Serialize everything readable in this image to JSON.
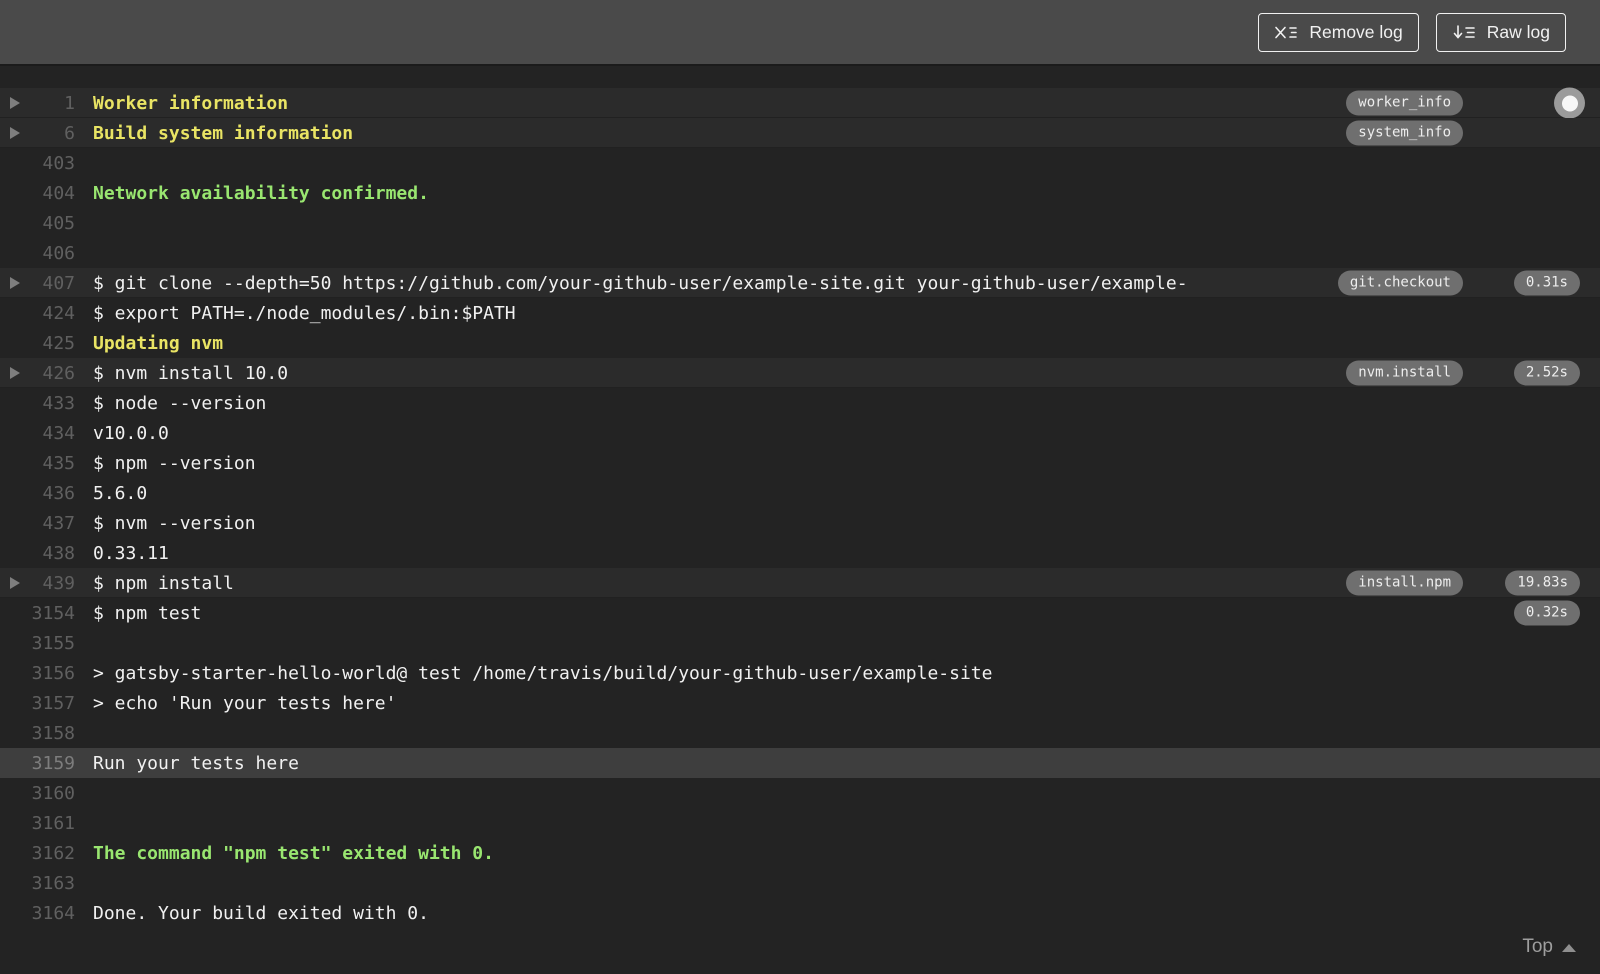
{
  "header": {
    "remove_log_label": "Remove log",
    "raw_log_label": "Raw log"
  },
  "log": {
    "rows": [
      {
        "num": "1",
        "text": "Worker information",
        "color": "yellow",
        "fold": true,
        "arrow": true,
        "tag": "worker_info",
        "knob": true
      },
      {
        "num": "6",
        "text": "Build system information",
        "color": "yellow",
        "fold": true,
        "arrow": true,
        "tag": "system_info"
      },
      {
        "num": "403",
        "text": ""
      },
      {
        "num": "404",
        "text": "Network availability confirmed.",
        "color": "green"
      },
      {
        "num": "405",
        "text": ""
      },
      {
        "num": "406",
        "text": ""
      },
      {
        "num": "407",
        "text": "$ git clone --depth=50 https://github.com/your-github-user/example-site.git your-github-user/example-",
        "fold": true,
        "arrow": true,
        "tag": "git.checkout",
        "duration": "0.31s"
      },
      {
        "num": "424",
        "text": "$ export PATH=./node_modules/.bin:$PATH"
      },
      {
        "num": "425",
        "text": "Updating nvm",
        "color": "yellow"
      },
      {
        "num": "426",
        "text": "$ nvm install 10.0",
        "fold": true,
        "arrow": true,
        "tag": "nvm.install",
        "duration": "2.52s"
      },
      {
        "num": "433",
        "text": "$ node --version"
      },
      {
        "num": "434",
        "text": "v10.0.0"
      },
      {
        "num": "435",
        "text": "$ npm --version"
      },
      {
        "num": "436",
        "text": "5.6.0"
      },
      {
        "num": "437",
        "text": "$ nvm --version"
      },
      {
        "num": "438",
        "text": "0.33.11"
      },
      {
        "num": "439",
        "text": "$ npm install",
        "fold": true,
        "arrow": true,
        "tag": "install.npm",
        "duration": "19.83s"
      },
      {
        "num": "3154",
        "text": "$ npm test",
        "duration": "0.32s"
      },
      {
        "num": "3155",
        "text": ""
      },
      {
        "num": "3156",
        "text": "> gatsby-starter-hello-world@ test /home/travis/build/your-github-user/example-site"
      },
      {
        "num": "3157",
        "text": "> echo 'Run your tests here'"
      },
      {
        "num": "3158",
        "text": ""
      },
      {
        "num": "3159",
        "text": "Run your tests here",
        "selected": true
      },
      {
        "num": "3160",
        "text": ""
      },
      {
        "num": "3161",
        "text": ""
      },
      {
        "num": "3162",
        "text": "The command \"npm test\" exited with 0.",
        "color": "green"
      },
      {
        "num": "3163",
        "text": ""
      },
      {
        "num": "3164",
        "text": "Done. Your build exited with 0."
      }
    ],
    "top_link_label": "Top"
  },
  "colors": {
    "header_bg": "#4a4a4a",
    "log_bg": "#232323",
    "fold_row_bg": "#2b2b2b",
    "selected_row_bg": "#3e3e3e",
    "yellow_text": "#e9e464",
    "green_text": "#99e670",
    "pill_bg": "#6f6f6f",
    "line_number": "#606060"
  }
}
